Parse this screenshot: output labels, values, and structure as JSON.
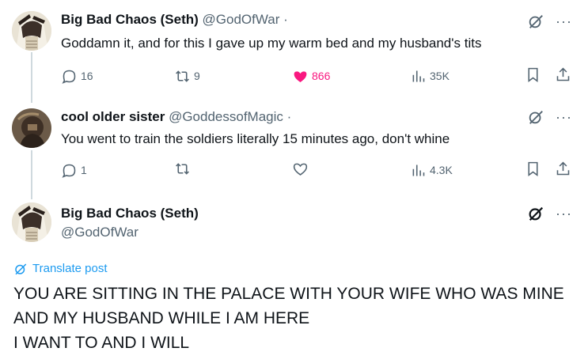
{
  "tweets": [
    {
      "name": "Big Bad Chaos (Seth)",
      "handle": "@GodOfWar",
      "separator": "·",
      "text": "Goddamn it, and for this I gave up my warm bed and my husband's tits",
      "replies": "16",
      "retweets": "9",
      "likes": "866",
      "views": "35K",
      "liked": true
    },
    {
      "name": "cool older sister",
      "handle": "@GoddessofMagic",
      "separator": "·",
      "text": "You went to train the soldiers literally 15 minutes ago, don't whine",
      "replies": "1",
      "retweets": "",
      "likes": "",
      "views": "4.3K",
      "liked": false
    }
  ],
  "main_post": {
    "name": "Big Bad Chaos (Seth)",
    "handle": "@GodOfWar",
    "translate_label": "Translate post",
    "lines": [
      "YOU ARE SITTING IN THE PALACE WITH YOUR WIFE WHO WAS MINE",
      "AND MY HUSBAND WHILE I AM HERE",
      "I WANT TO AND I WILL"
    ]
  },
  "more_label": "···",
  "colors": {
    "like_active": "#f91880",
    "link": "#1d9bf0",
    "muted": "#536471",
    "thread_line": "#cfd9de"
  },
  "icons": [
    "reply-icon",
    "retweet-icon",
    "heart-icon",
    "views-icon",
    "bookmark-icon",
    "share-icon",
    "grok-icon",
    "more-icon",
    "translate-icon"
  ]
}
